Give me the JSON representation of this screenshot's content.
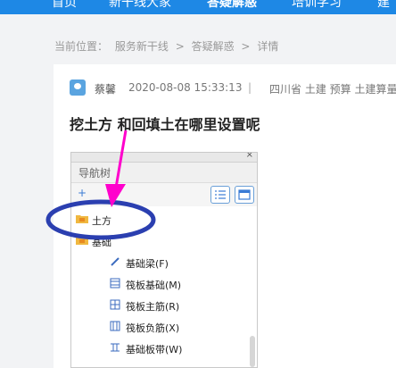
{
  "nav": {
    "items": [
      {
        "label": "首页"
      },
      {
        "label": "新干线大家"
      },
      {
        "label": "答疑解惑"
      },
      {
        "label": "培训学习"
      },
      {
        "label": "建"
      }
    ]
  },
  "breadcrumb": {
    "prefix": "当前位置：",
    "crumbs": [
      "服务新干线",
      "答疑解惑",
      "详情"
    ],
    "separator": ">"
  },
  "post": {
    "author": "蔡馨",
    "date": "2020-08-08 15:33:13",
    "separator": "|",
    "tags": "四川省  土建 预算 土建算量",
    "title": "挖土方 和回填土在哪里设置呢"
  },
  "screenshot": {
    "close": "×",
    "panel_title": "导航树",
    "toolbar_add": "+",
    "tree": [
      {
        "label": "土方",
        "icon": "folder-icon"
      },
      {
        "label": "基础",
        "icon": "folder-icon"
      },
      {
        "label": "基础梁(F)",
        "icon": "pencil-icon"
      },
      {
        "label": "筏板基础(M)",
        "icon": "grid-icon"
      },
      {
        "label": "筏板主筋(R)",
        "icon": "rebar-icon"
      },
      {
        "label": "筏板负筋(X)",
        "icon": "rebar-neg-icon"
      },
      {
        "label": "基础板带(W)",
        "icon": "strip-icon"
      }
    ]
  },
  "annotation": {
    "color": "#2b3fb0",
    "arrow_color": "#ff00cc"
  }
}
